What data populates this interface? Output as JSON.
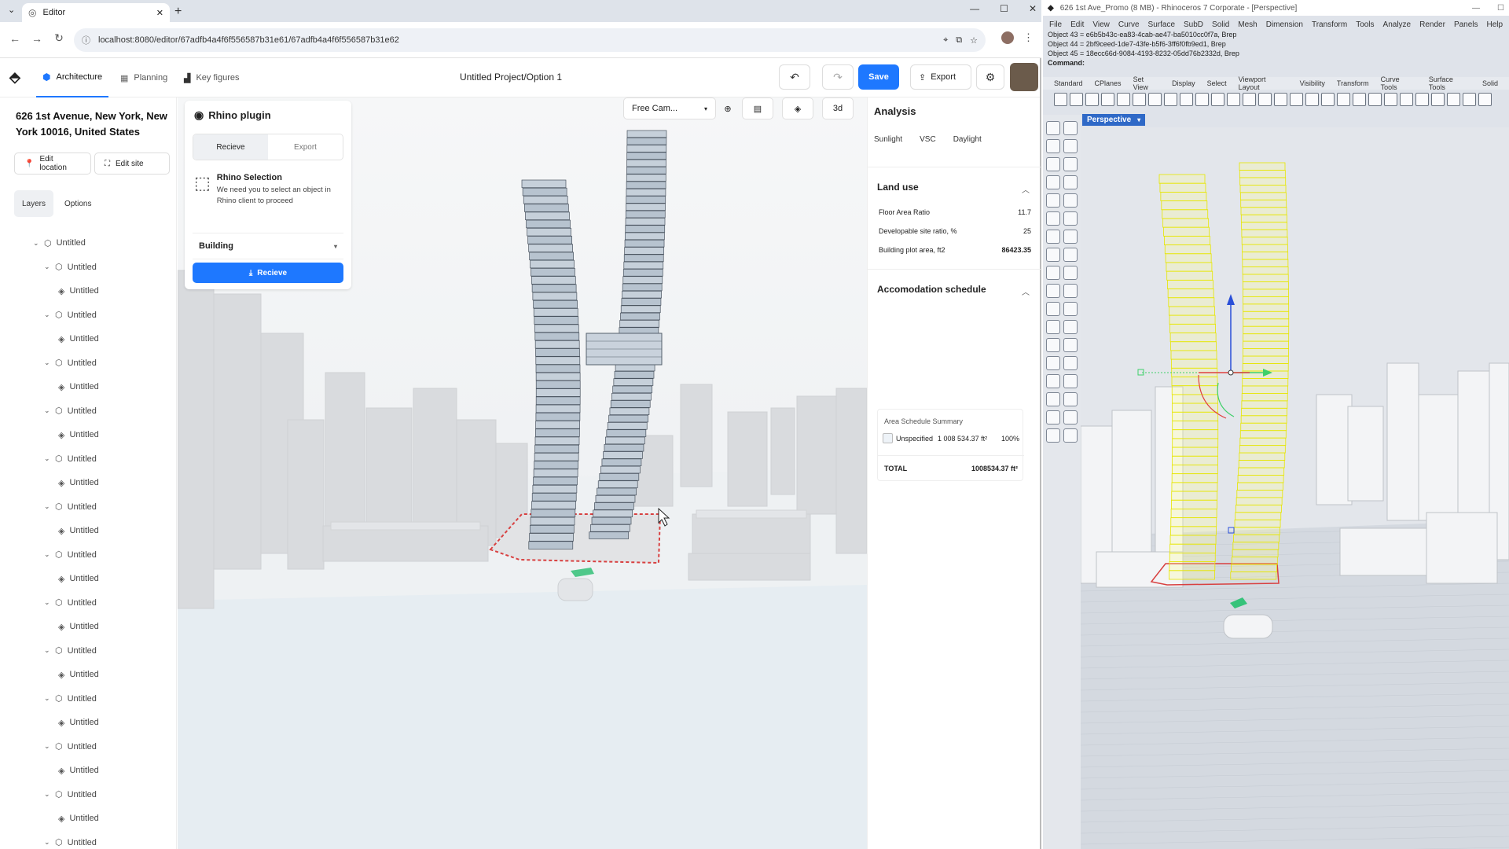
{
  "browser": {
    "tab_title": "Editor",
    "url": "localhost:8080/editor/67adfb4a4f6f556587b31e61/67adfb4a4f6f556587b31e62"
  },
  "header": {
    "nav": [
      "Architecture",
      "Planning",
      "Key figures"
    ],
    "project_title": "Untitled Project/Option 1",
    "save_label": "Save",
    "export_label": "Export"
  },
  "left": {
    "address": "626 1st Avenue, New York, New York 10016, United States",
    "edit_location": "Edit location",
    "edit_site": "Edit site",
    "tabs": [
      "Layers",
      "Options"
    ],
    "tree_label": "Untitled"
  },
  "plugin": {
    "title": "Rhino plugin",
    "tabs": [
      "Recieve",
      "Export"
    ],
    "selection_title": "Rhino Selection",
    "selection_desc": "We need you to select an object in Rhino client to proceed",
    "dropdown_value": "Building",
    "button_label": "Recieve"
  },
  "viewport": {
    "camera": "Free Cam...",
    "mode": "3d"
  },
  "analysis": {
    "title": "Analysis",
    "tabs": [
      "Sunlight",
      "VSC",
      "Daylight"
    ],
    "land_use": {
      "title": "Land use",
      "rows": [
        {
          "label": "Floor Area Ratio",
          "value": "11.7"
        },
        {
          "label": "Developable site ratio, %",
          "value": "25"
        },
        {
          "label": "Building plot area, ft2",
          "value": "86423.35"
        }
      ]
    },
    "accomodation": {
      "title": "Accomodation schedule",
      "card_title": "Area Schedule Summary",
      "row_label": "Unspecified",
      "row_area": "1 008 534.37 ft²",
      "row_pct": "100%",
      "total_label": "TOTAL",
      "total_value": "1008534.37 ft²"
    }
  },
  "rhino": {
    "title": "626 1st Ave_Promo (8 MB) - Rhinoceros 7 Corporate - [Perspective]",
    "menu": [
      "File",
      "Edit",
      "View",
      "Curve",
      "Surface",
      "SubD",
      "Solid",
      "Mesh",
      "Dimension",
      "Transform",
      "Tools",
      "Analyze",
      "Render",
      "Panels",
      "Help"
    ],
    "cmd_lines": [
      "Object 43 = e6b5b43c-ea83-4cab-ae47-ba5010cc0f7a, Brep",
      "Object 44 = 2bf9ceed-1de7-43fe-b5f6-3ff6f0fb9ed1, Brep",
      "Object 45 = 18ecc66d-9084-4193-8232-05dd76b2332d, Brep"
    ],
    "command_label": "Command:",
    "toolbar_tabs": [
      "Standard",
      "CPlanes",
      "Set View",
      "Display",
      "Select",
      "Viewport Layout",
      "Visibility",
      "Transform",
      "Curve Tools",
      "Surface Tools",
      "Solid"
    ],
    "viewport_label": "Perspective"
  }
}
